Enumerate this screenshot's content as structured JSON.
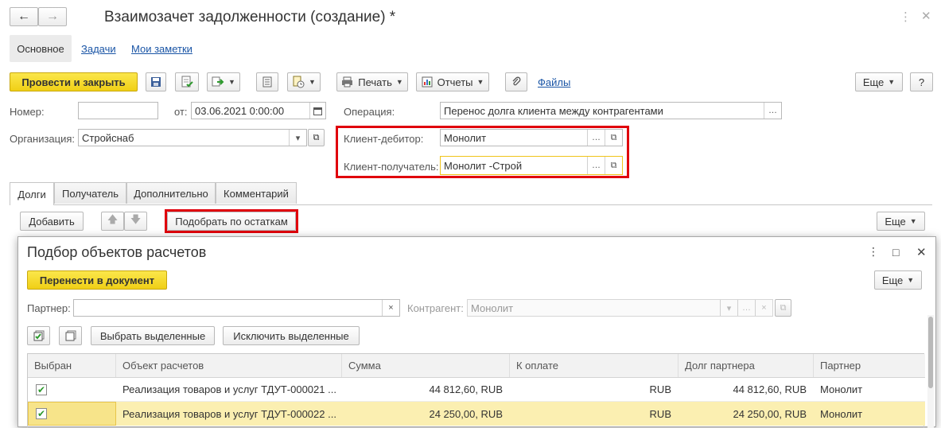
{
  "window": {
    "title": "Взаимозачет задолженности (создание) *",
    "nav_back": "←",
    "nav_forward": "→"
  },
  "nav_tabs": {
    "main": "Основное",
    "tasks": "Задачи",
    "notes": "Мои заметки"
  },
  "toolbar": {
    "post_close": "Провести и закрыть",
    "print": "Печать",
    "reports": "Отчеты",
    "files": "Файлы",
    "more": "Еще",
    "help": "?"
  },
  "form": {
    "number_label": "Номер:",
    "number_value": "",
    "date_label": "от:",
    "date_value": "03.06.2021  0:00:00",
    "operation_label": "Операция:",
    "operation_value": "Перенос долга клиента между контрагентами",
    "org_label": "Организация:",
    "org_value": "Стройснаб",
    "debtor_label": "Клиент-дебитор:",
    "debtor_value": "Монолит",
    "receiver_label": "Клиент-получатель:",
    "receiver_value": "Монолит -Строй"
  },
  "tabs": [
    "Долги",
    "Получатель",
    "Дополнительно",
    "Комментарий"
  ],
  "debts_toolbar": {
    "add": "Добавить",
    "pick": "Подобрать по остаткам",
    "more": "Еще"
  },
  "dialog": {
    "title": "Подбор объектов расчетов",
    "transfer": "Перенести в документ",
    "more": "Еще",
    "partner_label": "Партнер:",
    "partner_value": "",
    "contractor_label": "Контрагент:",
    "contractor_value": "Монолит",
    "select_selected": "Выбрать выделенные",
    "exclude_selected": "Исключить выделенные"
  },
  "table": {
    "columns": [
      "Выбран",
      "Объект расчетов",
      "Сумма",
      "К оплате",
      "Долг партнера",
      "Партнер"
    ],
    "rows": [
      {
        "checked": "✔",
        "object": "Реализация товаров и услуг ТДУТ-000021 ...",
        "sum": "44 812,60, RUB",
        "to_pay": "RUB",
        "debt": "44 812,60, RUB",
        "partner": "Монолит"
      },
      {
        "checked": "✔",
        "object": "Реализация товаров и услуг ТДУТ-000022 ...",
        "sum": "24 250,00, RUB",
        "to_pay": "RUB",
        "debt": "24 250,00, RUB",
        "partner": "Монолит"
      }
    ]
  },
  "icons": {
    "dots": "…",
    "dropdown": "▾",
    "open": "⧉",
    "clear": "×",
    "dialog_menu": "⋮",
    "dialog_max": "□",
    "dialog_close": "✕"
  },
  "colors": {
    "accent_yellow": "#f5d523",
    "highlight": "#e0000c",
    "selected_row": "#fbefb1",
    "link": "#1a55a6"
  }
}
